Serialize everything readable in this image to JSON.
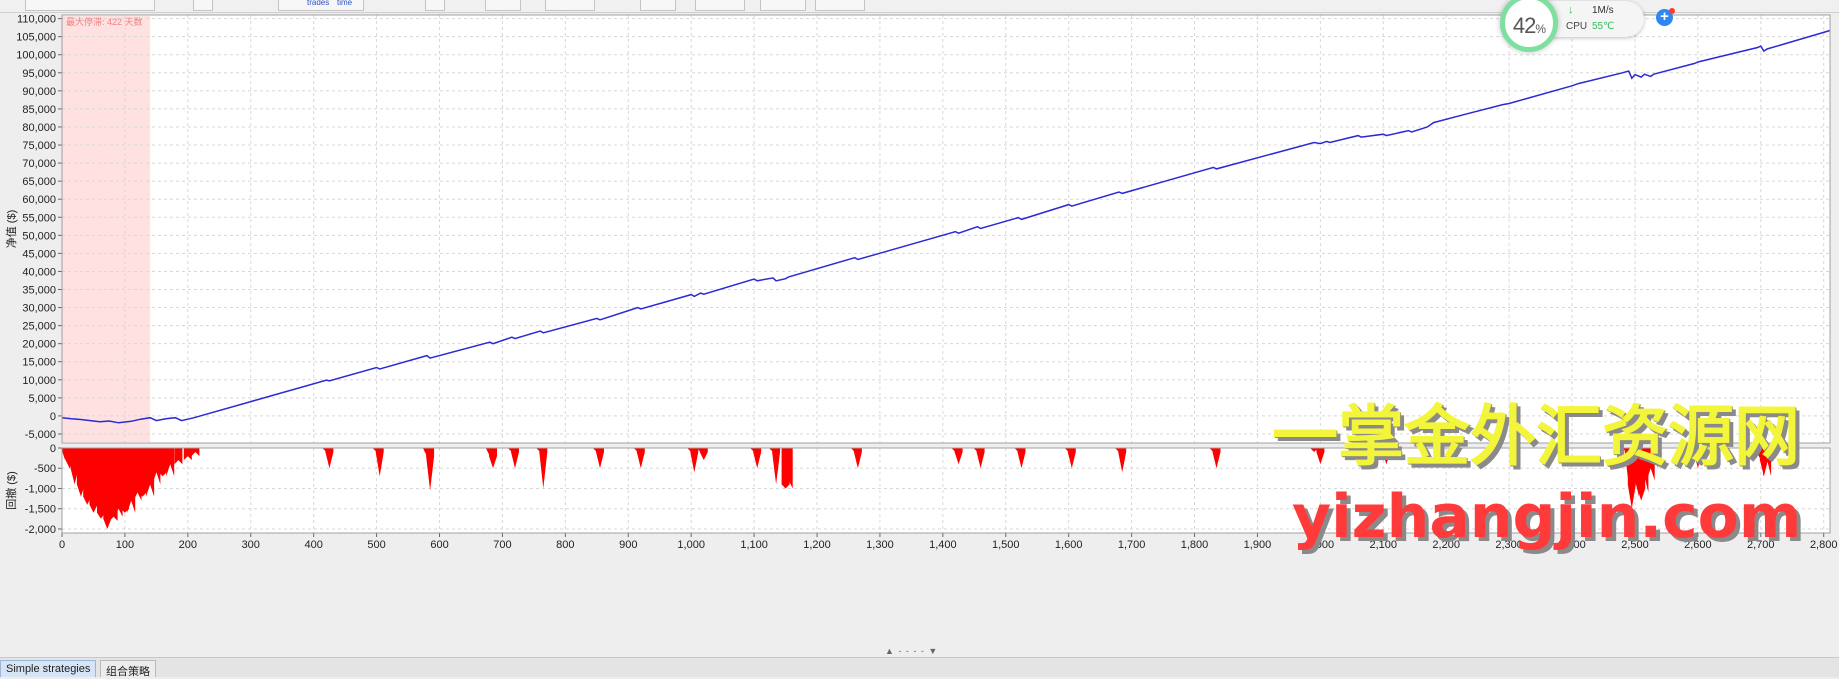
{
  "toolbar": {
    "trades_label": "trades",
    "time_label": "time"
  },
  "system_monitor": {
    "load_value": "42",
    "load_unit": "%",
    "net_speed": "1M/s",
    "cpu_label": "CPU",
    "cpu_temp": "55℃",
    "colors": {
      "ring": "#7ee0a0",
      "good": "#2fbf5b",
      "plus": "#2e86f0"
    }
  },
  "watermark": {
    "line1": "一掌金外汇资源网",
    "line2": "yizhangjin.com"
  },
  "tabs": [
    {
      "label": "Simple strategies",
      "active": true
    },
    {
      "label": "组合策略",
      "active": false
    }
  ],
  "chart_data": [
    {
      "type": "line",
      "ylabel": "净值 ($)",
      "annotation": "最大停滞: 422 天数",
      "xlim": [
        0,
        2810
      ],
      "ylim": [
        -7500,
        111000
      ],
      "yticks": [
        -5000,
        0,
        5000,
        10000,
        15000,
        20000,
        25000,
        30000,
        35000,
        40000,
        45000,
        50000,
        55000,
        60000,
        65000,
        70000,
        75000,
        80000,
        85000,
        90000,
        95000,
        100000,
        105000,
        110000
      ],
      "ytick_labels": [
        "-5,000",
        "0",
        "5,000",
        "10,000",
        "15,000",
        "20,000",
        "25,000",
        "30,000",
        "35,000",
        "40,000",
        "45,000",
        "50,000",
        "55,000",
        "60,000",
        "65,000",
        "70,000",
        "75,000",
        "80,000",
        "85,000",
        "90,000",
        "95,000",
        "100,000",
        "105,000",
        "110,000"
      ],
      "stagnation_range": [
        0,
        140
      ],
      "grid": true,
      "series": [
        {
          "color": "#2a2ad6",
          "x": [
            0,
            15,
            30,
            45,
            60,
            75,
            90,
            110,
            125,
            140,
            150,
            165,
            180,
            190,
            200,
            210,
            420,
            425,
            500,
            505,
            580,
            585,
            680,
            685,
            715,
            720,
            760,
            765,
            850,
            855,
            915,
            920,
            1000,
            1005,
            1015,
            1020,
            1100,
            1105,
            1130,
            1135,
            1150,
            1155,
            1260,
            1265,
            1420,
            1425,
            1455,
            1460,
            1520,
            1525,
            1600,
            1605,
            1680,
            1685,
            1830,
            1835,
            1990,
            2000,
            2010,
            2015,
            2060,
            2065,
            2100,
            2105,
            2140,
            2145,
            2170,
            2180,
            2230,
            2290,
            2300,
            2400,
            2410,
            2480,
            2490,
            2495,
            2500,
            2510,
            2515,
            2525,
            2530,
            2595,
            2600,
            2695,
            2700,
            2705,
            2710,
            2810
          ],
          "y": [
            -500,
            -800,
            -1000,
            -1300,
            -1600,
            -1400,
            -1900,
            -1500,
            -900,
            -500,
            -1300,
            -800,
            -500,
            -1300,
            -900,
            -500,
            9900,
            9700,
            13400,
            13000,
            16700,
            16000,
            20400,
            20000,
            21800,
            21400,
            23500,
            23000,
            27000,
            26600,
            30000,
            29600,
            33600,
            33100,
            34000,
            33700,
            37900,
            37400,
            38200,
            37400,
            38000,
            38500,
            43800,
            43300,
            51000,
            50600,
            52400,
            51900,
            54900,
            54400,
            58500,
            58100,
            62000,
            61600,
            68800,
            68400,
            75700,
            75400,
            76000,
            75700,
            77600,
            77200,
            78000,
            77600,
            79000,
            78600,
            80000,
            81200,
            83500,
            86200,
            86500,
            91400,
            92000,
            95000,
            95500,
            93500,
            94500,
            93800,
            94600,
            94000,
            94600,
            97600,
            98000,
            102000,
            102400,
            101000,
            101600,
            106700
          ]
        }
      ]
    },
    {
      "type": "area",
      "ylabel": "回撤 ($)",
      "xlim": [
        0,
        2810
      ],
      "ylim": [
        -2100,
        0
      ],
      "yticks": [
        0,
        -500,
        -1000,
        -1500,
        -2000
      ],
      "ytick_labels": [
        "0",
        "-500",
        "-1,000",
        "-1,500",
        "-2,000"
      ],
      "xticks": [
        0,
        100,
        200,
        300,
        400,
        500,
        600,
        700,
        800,
        900,
        1000,
        1100,
        1200,
        1300,
        1400,
        1500,
        1600,
        1700,
        1800,
        1900,
        2000,
        2100,
        2200,
        2300,
        2400,
        2500,
        2600,
        2700,
        2800
      ],
      "xtick_labels": [
        "0",
        "100",
        "200",
        "300",
        "400",
        "500",
        "600",
        "700",
        "800",
        "900",
        "1,000",
        "1,100",
        "1,200",
        "1,300",
        "1,400",
        "1,500",
        "1,600",
        "1,700",
        "1,800",
        "1,900",
        "2,000",
        "2,100",
        "2,200",
        "2,300",
        "2,400",
        "2,500",
        "2,600",
        "2,700",
        "2,800"
      ],
      "grid": true,
      "series": [
        {
          "color": "#ff0000",
          "spikes": [
            [
              5,
              0,
              -300
            ],
            [
              12,
              -300,
              -500
            ],
            [
              20,
              -500,
              -900
            ],
            [
              30,
              -900,
              -1200
            ],
            [
              40,
              -1200,
              -1400
            ],
            [
              50,
              -1400,
              -1600
            ],
            [
              62,
              -1600,
              -1750
            ],
            [
              72,
              -1750,
              -2000
            ],
            [
              82,
              -1800,
              -1700
            ],
            [
              90,
              -1700,
              -1500
            ],
            [
              100,
              -1500,
              -1600
            ],
            [
              110,
              -1600,
              -1300
            ],
            [
              120,
              -1300,
              -1100
            ],
            [
              128,
              -1100,
              -1200
            ],
            [
              140,
              -1200,
              -900
            ],
            [
              150,
              -900,
              -600
            ],
            [
              160,
              -600,
              -700
            ],
            [
              172,
              -700,
              -400
            ],
            [
              185,
              -400,
              -300
            ],
            [
              200,
              -300,
              -200
            ],
            [
              212,
              -200,
              -100
            ],
            [
              420,
              0,
              -100
            ],
            [
              425,
              -100,
              -500
            ],
            [
              500,
              0,
              -100
            ],
            [
              505,
              -100,
              -700
            ],
            [
              580,
              0,
              -200
            ],
            [
              585,
              -200,
              -1050
            ],
            [
              680,
              0,
              -200
            ],
            [
              685,
              -200,
              -500
            ],
            [
              715,
              0,
              -100
            ],
            [
              720,
              -100,
              -500
            ],
            [
              760,
              0,
              -100
            ],
            [
              765,
              -100,
              -1000
            ],
            [
              850,
              0,
              -100
            ],
            [
              855,
              -100,
              -500
            ],
            [
              915,
              0,
              -100
            ],
            [
              920,
              -100,
              -500
            ],
            [
              1000,
              0,
              -100
            ],
            [
              1005,
              -100,
              -600
            ],
            [
              1015,
              0,
              -100
            ],
            [
              1020,
              -100,
              -300
            ],
            [
              1100,
              0,
              -100
            ],
            [
              1105,
              -100,
              -500
            ],
            [
              1130,
              0,
              -100
            ],
            [
              1135,
              -100,
              -900
            ],
            [
              1150,
              -900,
              -1000
            ],
            [
              1155,
              -1000,
              -800
            ],
            [
              1260,
              0,
              -100
            ],
            [
              1265,
              -100,
              -500
            ],
            [
              1420,
              0,
              -100
            ],
            [
              1425,
              -100,
              -400
            ],
            [
              1455,
              0,
              -100
            ],
            [
              1460,
              -100,
              -500
            ],
            [
              1520,
              0,
              -100
            ],
            [
              1525,
              -100,
              -500
            ],
            [
              1600,
              0,
              -100
            ],
            [
              1605,
              -100,
              -500
            ],
            [
              1680,
              0,
              -100
            ],
            [
              1685,
              -100,
              -600
            ],
            [
              1830,
              0,
              -100
            ],
            [
              1835,
              -100,
              -500
            ],
            [
              1990,
              0,
              -100
            ],
            [
              2000,
              -100,
              -400
            ],
            [
              2060,
              0,
              -100
            ],
            [
              2065,
              -100,
              -400
            ],
            [
              2100,
              0,
              -100
            ],
            [
              2105,
              -100,
              -400
            ],
            [
              2480,
              0,
              -100
            ],
            [
              2490,
              -100,
              -900
            ],
            [
              2495,
              -900,
              -1500
            ],
            [
              2500,
              -1200,
              -800
            ],
            [
              2510,
              -1000,
              -1300
            ],
            [
              2515,
              -1100,
              -700
            ],
            [
              2525,
              -800,
              -500
            ],
            [
              2530,
              -500,
              -100
            ],
            [
              2595,
              0,
              -100
            ],
            [
              2600,
              -100,
              -500
            ],
            [
              2695,
              0,
              -100
            ],
            [
              2700,
              -100,
              -300
            ],
            [
              2705,
              -300,
              -700
            ],
            [
              2710,
              -700,
              -300
            ]
          ]
        }
      ]
    }
  ]
}
